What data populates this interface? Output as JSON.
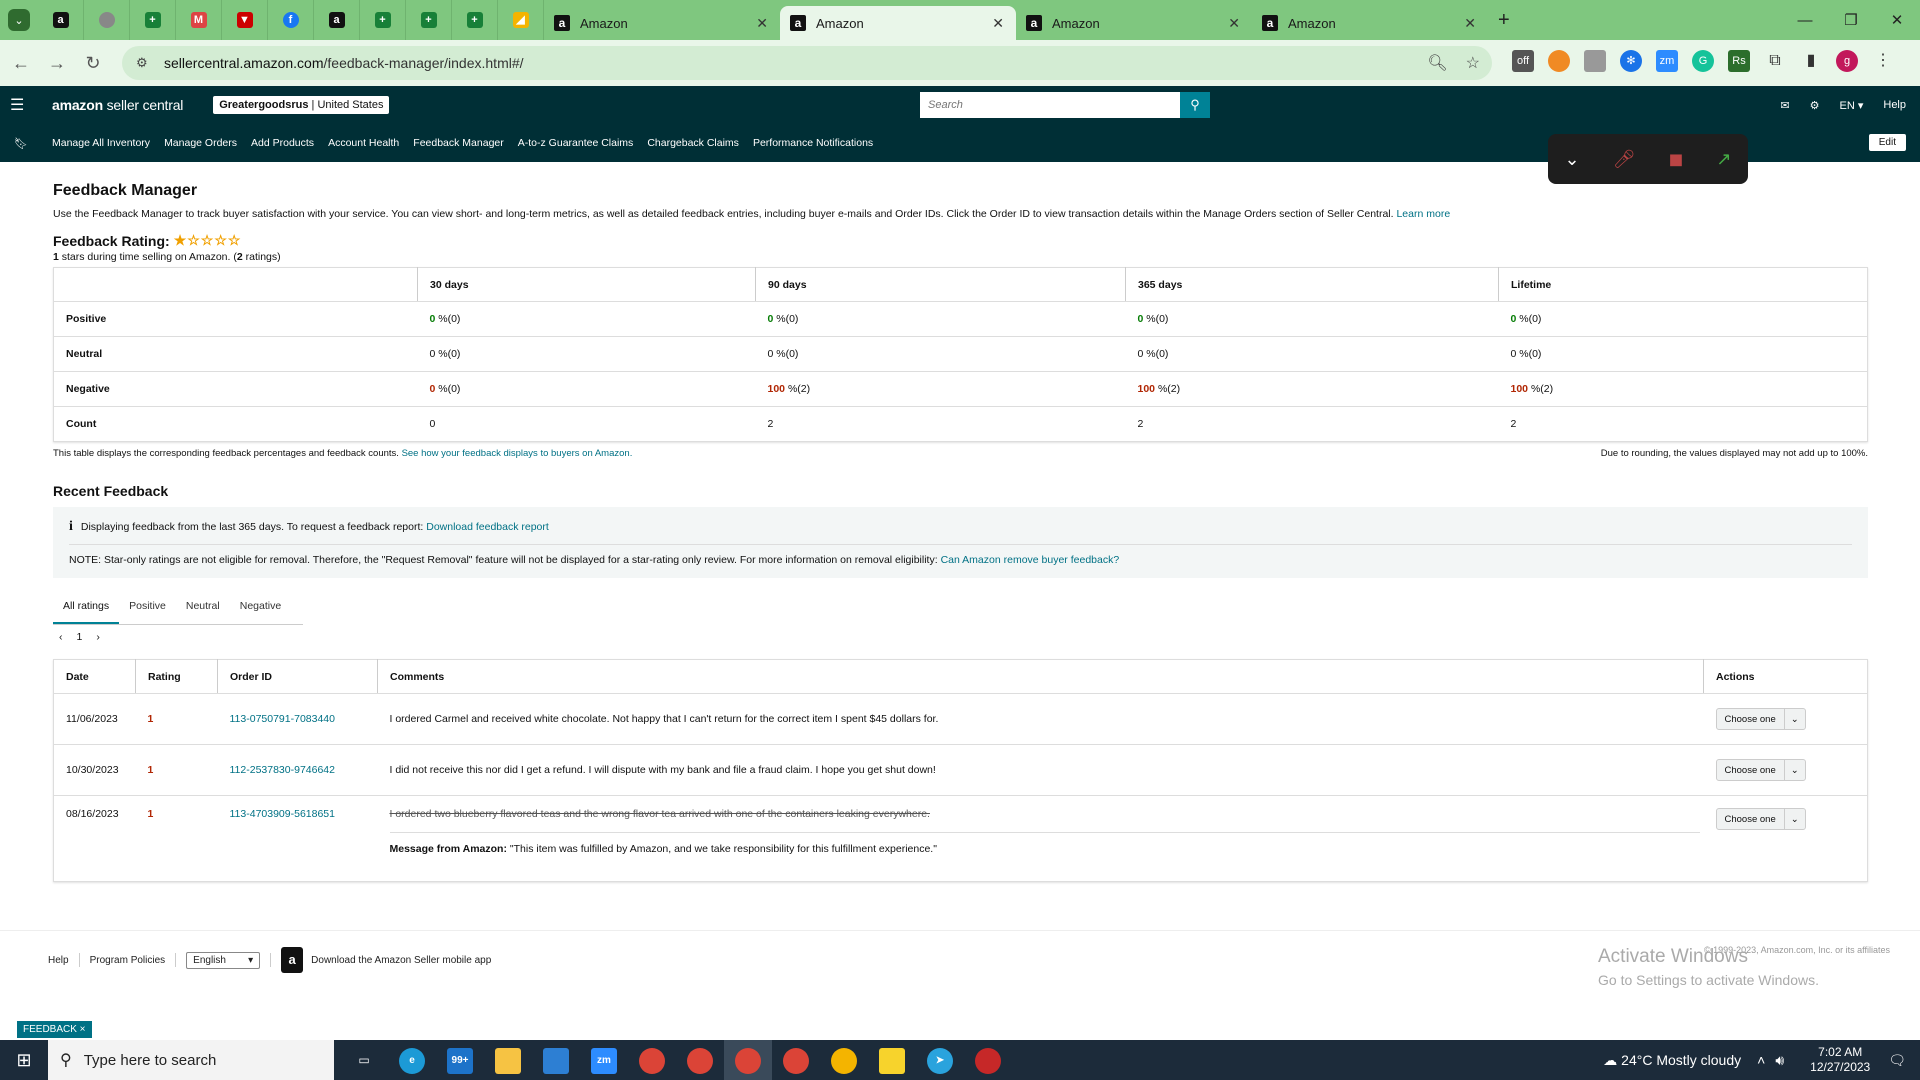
{
  "browser": {
    "tabs": [
      {
        "label": "Amazon",
        "active": false
      },
      {
        "label": "Amazon",
        "active": true
      },
      {
        "label": "Amazon",
        "active": false
      },
      {
        "label": "Amazon",
        "active": false
      }
    ],
    "url_domain": "sellercentral.amazon.com",
    "url_path": "/feedback-manager/index.html#/"
  },
  "header": {
    "logo_bold": "amazon",
    "logo_rest": " seller central",
    "store_name": "Greatergoodsrus",
    "store_region": "United States",
    "search_placeholder": "Search",
    "lang": "EN",
    "help": "Help"
  },
  "nav": {
    "items": [
      "Manage All Inventory",
      "Manage Orders",
      "Add Products",
      "Account Health",
      "Feedback Manager",
      "A-to-z Guarantee Claims",
      "Chargeback Claims",
      "Performance Notifications"
    ],
    "edit": "Edit"
  },
  "page": {
    "title": "Feedback Manager",
    "intro": "Use the Feedback Manager to track buyer satisfaction with your service. You can view short- and long-term metrics, as well as detailed feedback entries, including buyer e-mails and Order IDs. Click the Order ID to view transaction details within the Manage Orders section of Seller Central.",
    "learn_more": "Learn more",
    "rating_label": "Feedback Rating:",
    "stars_filled": 1,
    "stars_total": 5,
    "rating_value": "1",
    "rating_sub_mid": " stars during time selling on Amazon. (",
    "rating_count": "2",
    "rating_sub_end": " ratings)"
  },
  "metrics": {
    "columns": [
      "30 days",
      "90 days",
      "365 days",
      "Lifetime"
    ],
    "rows": [
      {
        "label": "Positive",
        "cells": [
          [
            "0",
            " %(0)"
          ],
          [
            "0",
            " %(0)"
          ],
          [
            "0",
            " %(0)"
          ],
          [
            "0",
            " %(0)"
          ]
        ]
      },
      {
        "label": "Neutral",
        "cells": [
          [
            "0",
            " %(0)"
          ],
          [
            "0",
            " %(0)"
          ],
          [
            "0",
            " %(0)"
          ],
          [
            "0",
            " %(0)"
          ]
        ]
      },
      {
        "label": "Negative",
        "cells": [
          [
            "0",
            " %(0)"
          ],
          [
            "100",
            " %(2)"
          ],
          [
            "100",
            " %(2)"
          ],
          [
            "100",
            " %(2)"
          ]
        ]
      },
      {
        "label": "Count",
        "cells": [
          [
            "0",
            ""
          ],
          [
            "2",
            ""
          ],
          [
            "2",
            ""
          ],
          [
            "2",
            ""
          ]
        ]
      }
    ],
    "note_left": "This table displays the corresponding feedback percentages and feedback counts.",
    "note_link": "See how your feedback displays to buyers on Amazon.",
    "note_right": "Due to rounding, the values displayed may not add up to 100%."
  },
  "recent": {
    "title": "Recent Feedback",
    "info_text": "Displaying feedback from the last 365 days. To request a feedback report:",
    "info_link": "Download feedback report",
    "note_text": "NOTE: Star-only ratings are not eligible for removal. Therefore, the \"Request Removal\" feature will not be displayed for a star-rating only review. For more information on removal eligibility:",
    "note_link": "Can Amazon remove buyer feedback?",
    "tabs": [
      "All ratings",
      "Positive",
      "Neutral",
      "Negative"
    ],
    "page": "1",
    "columns": {
      "date": "Date",
      "rating": "Rating",
      "order": "Order ID",
      "comments": "Comments",
      "actions": "Actions"
    },
    "rows": [
      {
        "date": "11/06/2023",
        "rating": "1",
        "order": "113-0750791-7083440",
        "comment": "I ordered Carmel and received white chocolate. Not happy that I can't return for the correct item I spent $45 dollars for.",
        "action": "Choose one"
      },
      {
        "date": "10/30/2023",
        "rating": "1",
        "order": "112-2537830-9746642",
        "comment": "I did not receive this nor did I get a refund. I will dispute with my bank and file a fraud claim. I hope you get shut down!",
        "action": "Choose one"
      },
      {
        "date": "08/16/2023",
        "rating": "1",
        "order": "113-4703909-5618651",
        "comment": "I ordered two blueberry flavored teas and the wrong flavor tea arrived with one of the containers leaking everywhere.",
        "action": "Choose one",
        "amazon_label": "Message from Amazon:",
        "amazon_msg": " \"This item was fulfilled by Amazon, and we take responsibility for this fulfillment experience.\""
      }
    ]
  },
  "footer": {
    "help": "Help",
    "policies": "Program Policies",
    "lang": "English",
    "app": "Download the Amazon Seller mobile app",
    "copyright": "© 1999-2023, Amazon.com, Inc. or its affiliates",
    "activate1": "Activate Windows",
    "activate2": "Go to Settings to activate Windows.",
    "feedback": "FEEDBACK ×"
  },
  "taskbar": {
    "search_placeholder": "Type here to search",
    "weather": "24°C  Mostly cloudy",
    "time": "7:02 AM",
    "date": "12/27/2023"
  },
  "colors": {
    "header_bg": "#002f36",
    "link": "#007185",
    "negative": "#b12704",
    "positive": "#067d06",
    "tabbar": "#7fc77f"
  }
}
